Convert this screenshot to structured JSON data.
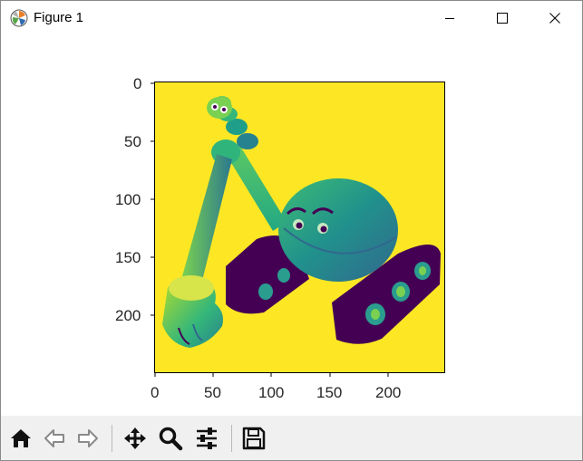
{
  "window": {
    "title": "Figure 1"
  },
  "plot": {
    "xticks": [
      "0",
      "50",
      "100",
      "150",
      "200"
    ],
    "yticks": [
      "0",
      "50",
      "100",
      "150",
      "200"
    ]
  },
  "image": {
    "description_colormap": "viridis",
    "background_color": "#fde725",
    "tread_color": "#440154"
  },
  "toolbar": {
    "buttons": [
      "home-icon",
      "back-icon",
      "forward-icon",
      "pan-icon",
      "zoom-icon",
      "configure-subplots-icon",
      "save-icon"
    ]
  }
}
